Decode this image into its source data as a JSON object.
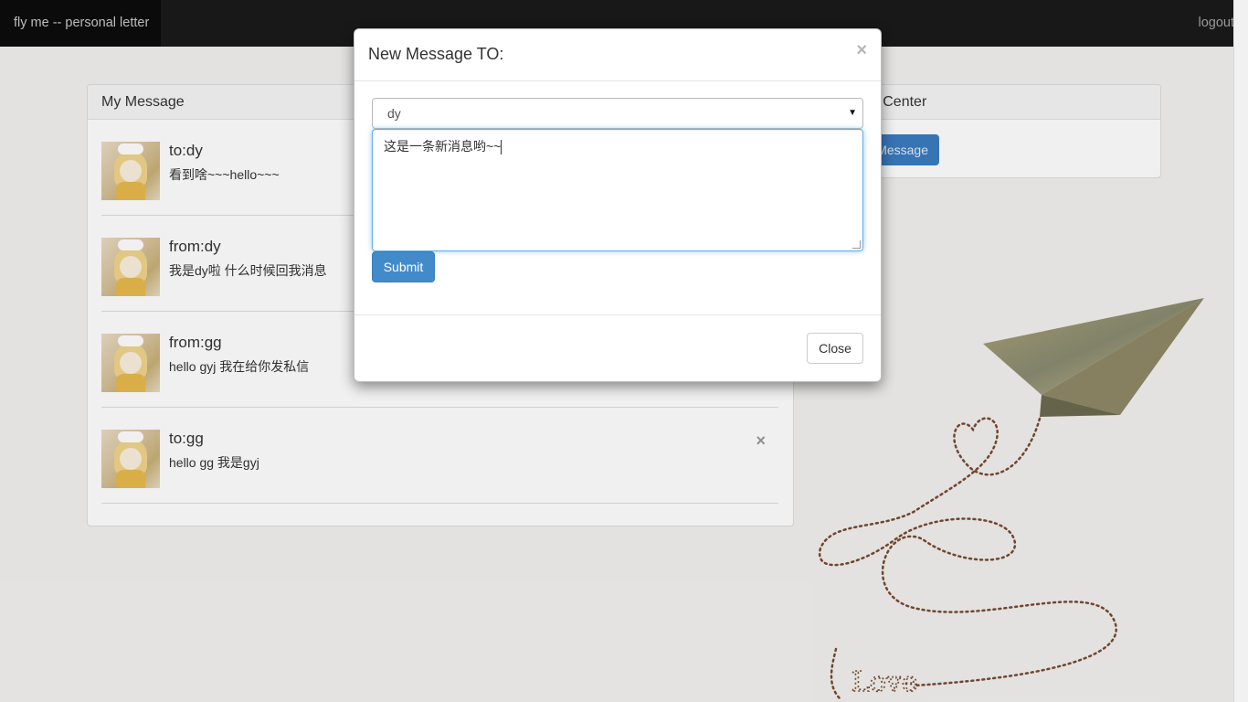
{
  "navbar": {
    "brand": "fly me -- personal letter",
    "logout": "logout"
  },
  "my_message": {
    "heading": "My Message",
    "items": [
      {
        "title": "to:dy",
        "body": "看到啥~~~hello~~~"
      },
      {
        "title": "from:dy",
        "body": "我是dy啦 什么时候回我消息"
      },
      {
        "title": "from:gg",
        "body": "hello gyj 我在给你发私信"
      },
      {
        "title": "to:gg",
        "body": "hello gg 我是gyj",
        "close": "×"
      }
    ]
  },
  "message_center": {
    "heading": "ge Center",
    "button": "Message"
  },
  "modal": {
    "title": "New Message TO:",
    "close_x": "×",
    "recipient_selected": "dy",
    "message_text": "这是一条新消息哟~~",
    "submit": "Submit",
    "close": "Close"
  },
  "decoration": {
    "text": "Love"
  }
}
